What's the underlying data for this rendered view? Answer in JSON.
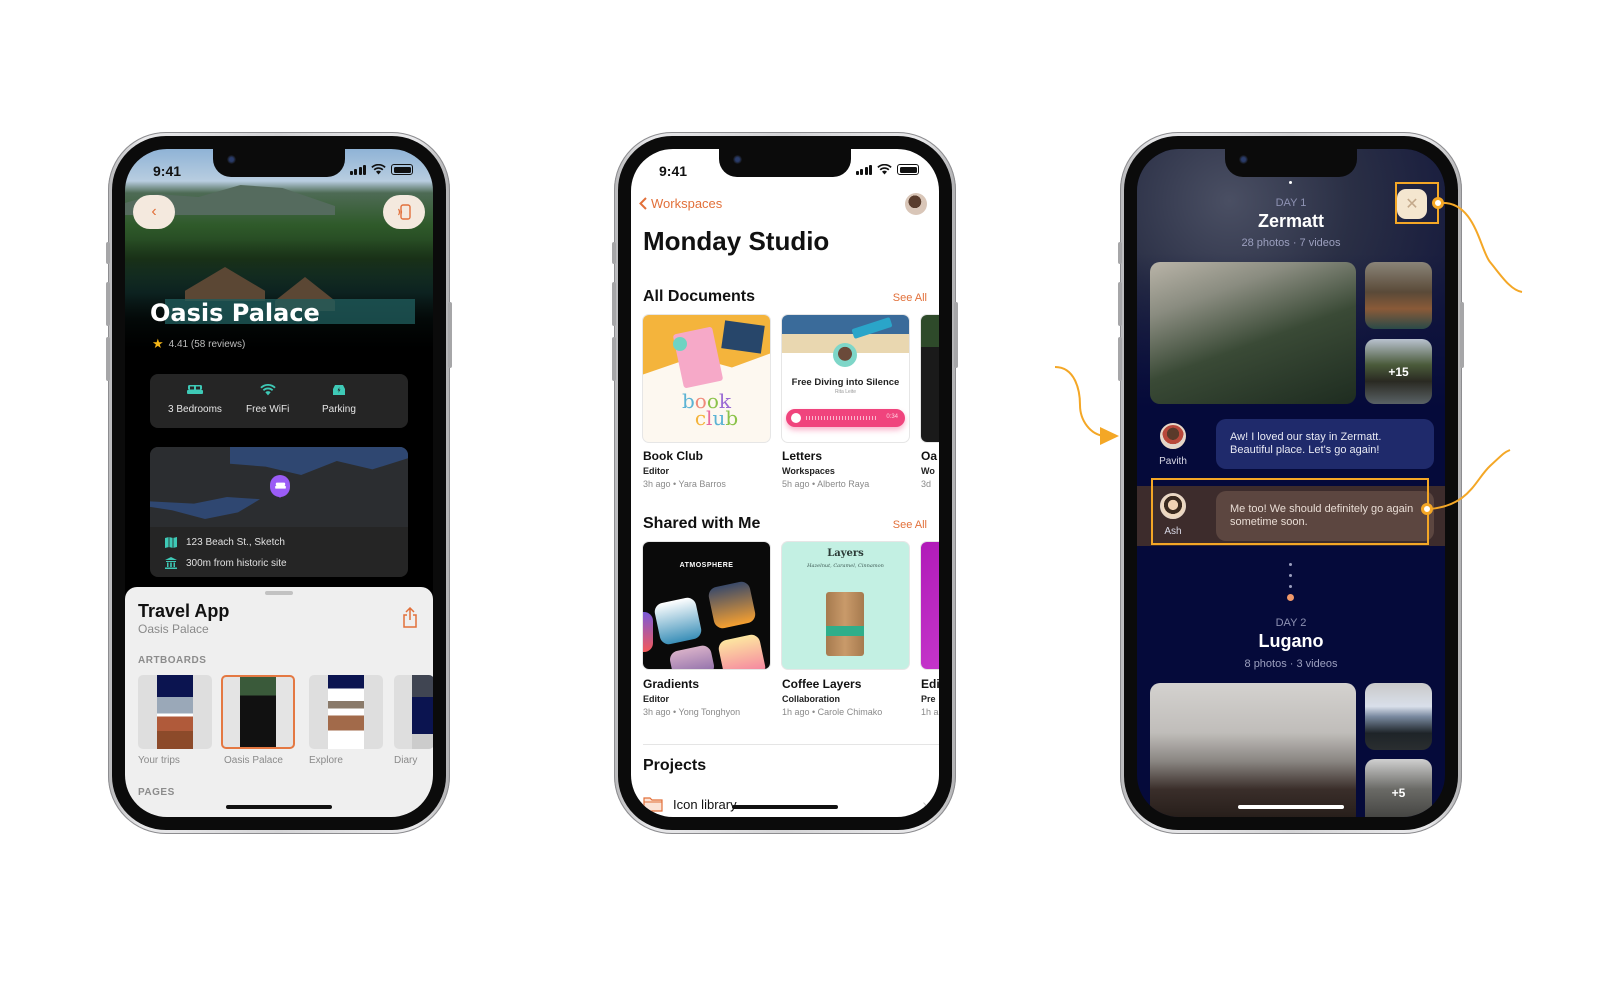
{
  "status_time": "9:41",
  "travel_phone": {
    "hotel_name": "Oasis Palace",
    "rating": "4.41 (58 reviews)",
    "amenities": [
      {
        "label": "3 Bedrooms",
        "icon": "bed-icon"
      },
      {
        "label": "Free WiFi",
        "icon": "wifi-icon"
      },
      {
        "label": "Parking",
        "icon": "car-icon"
      }
    ],
    "address": "123 Beach St., Sketch",
    "landmark": "300m from historic site",
    "sheet": {
      "title": "Travel App",
      "subtitle": "Oasis Palace",
      "artboards_label": "ARTBOARDS",
      "pages_label": "PAGES",
      "artboards": [
        {
          "label": "Your trips",
          "selected": false
        },
        {
          "label": "Oasis Palace",
          "selected": true
        },
        {
          "label": "Explore",
          "selected": false
        },
        {
          "label": "Diary",
          "selected": false
        }
      ]
    }
  },
  "studio_phone": {
    "back_label": "Workspaces",
    "title": "Monday Studio",
    "see_all": "See All",
    "all_documents": {
      "heading": "All Documents",
      "items": [
        {
          "title": "Book Club",
          "role": "Editor",
          "meta": "3h ago • Yara Barros",
          "thumb_text": "book club"
        },
        {
          "title": "Letters",
          "role": "Workspaces",
          "meta": "5h ago • Alberto Raya",
          "thumb_title": "Free Diving into Silence",
          "thumb_author": "Rita Leite",
          "thumb_duration": "0:34"
        },
        {
          "title": "Oa",
          "role": "Wo",
          "meta": "3d"
        }
      ]
    },
    "shared": {
      "heading": "Shared with Me",
      "items": [
        {
          "title": "Gradients",
          "role": "Editor",
          "meta": "3h ago • Yong Tonghyon",
          "thumb_text": "ATMOSPHERE"
        },
        {
          "title": "Coffee Layers",
          "role": "Collaboration",
          "meta": "1h ago • Carole Chimako",
          "thumb_title": "Layers",
          "thumb_sub": "Hazelnut, Caramel, Cinnamon"
        },
        {
          "title": "Edi",
          "role": "Pre",
          "meta": "1h a"
        }
      ]
    },
    "projects": {
      "heading": "Projects",
      "items": [
        {
          "label": "Icon library"
        }
      ]
    }
  },
  "diary_phone": {
    "days": [
      {
        "day": "DAY 1",
        "place": "Zermatt",
        "counts": "28 photos · 7 videos",
        "more": "+15"
      },
      {
        "day": "DAY 2",
        "place": "Lugano",
        "counts": "8 photos · 3 videos",
        "more": "+5"
      }
    ],
    "messages": [
      {
        "name": "Pavith",
        "text": "Aw! I loved our stay in Zermatt. Beautiful place. Let's go again!"
      },
      {
        "name": "Ash",
        "text": "Me too! We should definitely go again sometime soon."
      }
    ]
  },
  "colors": {
    "accent_orange": "#e2703a",
    "annotation": "#f4a726",
    "teal": "#3ec9b6",
    "diary_bg": "#050a3a"
  }
}
